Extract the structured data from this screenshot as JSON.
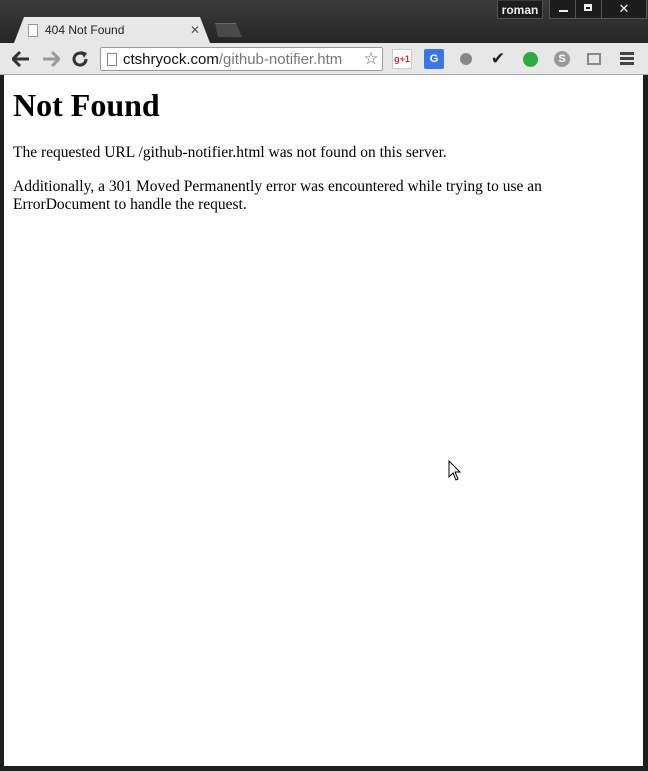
{
  "titlebar": {
    "profile_name": "roman",
    "close_glyph": "✕"
  },
  "tab": {
    "title": "404 Not Found",
    "close_glyph": "✕"
  },
  "toolbar": {
    "url_host": "ctshryock.com",
    "url_path": "/github-notifier.htm",
    "star_glyph": "☆",
    "back_glyph": "←",
    "forward_glyph": "→",
    "reload_glyph": "↻"
  },
  "extensions": {
    "gplus_label": "g+1",
    "translate_label": "G",
    "skype_label": "S",
    "check_glyph": "✔"
  },
  "page": {
    "heading": "Not Found",
    "paragraph1": "The requested URL /github-notifier.html was not found on this server.",
    "paragraph2": "Additionally, a 301 Moved Permanently error was encountered while trying to use an ErrorDocument to handle the request."
  },
  "colors": {
    "chrome_dark": "#2b2b2b",
    "toolbar": "#e7e7e7",
    "hangouts_green": "#2bab3e",
    "translate_blue": "#3b78e7"
  }
}
